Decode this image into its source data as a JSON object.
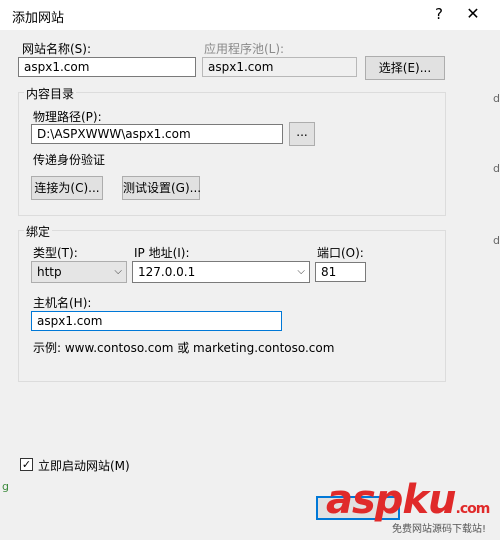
{
  "window": {
    "title": "添加网站",
    "help_glyph": "?",
    "close_glyph": "✕"
  },
  "site": {
    "name_label": "网站名称(S):",
    "name_value": "aspx1.com",
    "pool_label": "应用程序池(L):",
    "pool_value": "aspx1.com",
    "select_button": "选择(E)..."
  },
  "content_dir": {
    "group_title": "内容目录",
    "path_label": "物理路径(P):",
    "path_value": "D:\\ASPXWWW\\aspx1.com",
    "browse_button": "...",
    "auth_label": "传递身份验证",
    "connect_as_button": "连接为(C)...",
    "test_settings_button": "测试设置(G)..."
  },
  "binding": {
    "group_title": "绑定",
    "type_label": "类型(T):",
    "type_value": "http",
    "ip_label": "IP 地址(I):",
    "ip_value": "127.0.0.1",
    "port_label": "端口(O):",
    "port_value": "81",
    "host_label": "主机名(H):",
    "host_value": "aspx1.com",
    "example_text": "示例: www.contoso.com 或 marketing.contoso.com"
  },
  "start_site": {
    "checked": true,
    "check_glyph": "✓",
    "label": "立即启动网站(M)"
  },
  "watermark": {
    "brand": "aspku",
    "domain_suffix": ".com",
    "subtitle": "免费网站源码下载站!",
    "color": "#e02a2a"
  },
  "edge_fragments": [
    "d",
    "d",
    "d",
    "g"
  ]
}
